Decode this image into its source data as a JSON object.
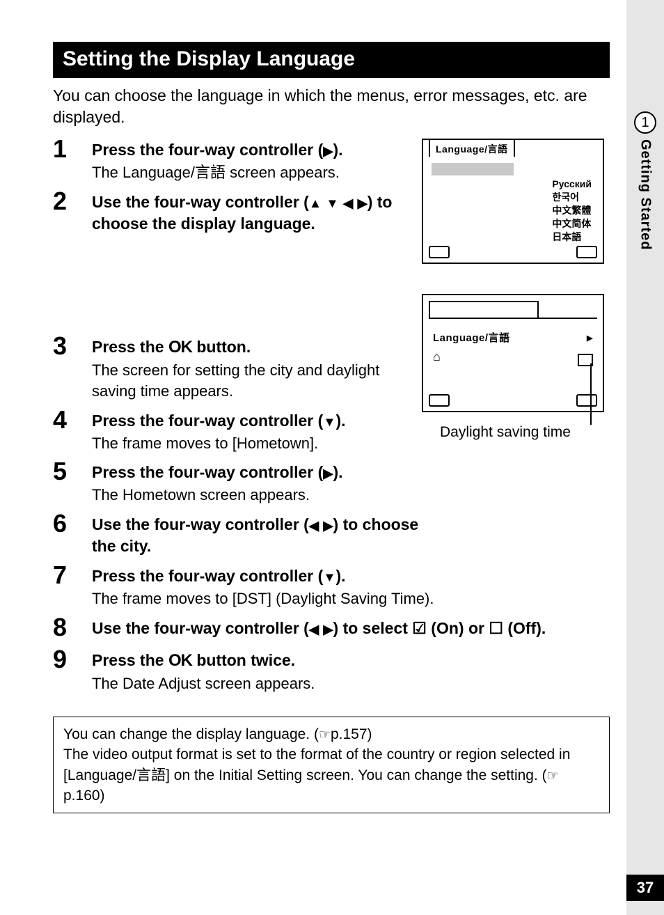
{
  "sidebar": {
    "chapter_num": "1",
    "chapter_label": "Getting Started",
    "page_number": "37"
  },
  "heading": "Setting the Display Language",
  "intro": "You can choose the language in which the menus, error messages, etc. are displayed.",
  "steps": [
    {
      "num": "1",
      "title_parts": [
        "Press the four-way controller (",
        ")."
      ],
      "desc_parts": [
        "The Language/",
        "言語",
        " screen appears."
      ]
    },
    {
      "num": "2",
      "title_parts": [
        "Use the four-way controller (",
        ") to choose the display language."
      ]
    },
    {
      "num": "3",
      "title_parts": [
        "Press the ",
        " button."
      ],
      "desc": "The screen for setting the city and daylight saving time appears."
    },
    {
      "num": "4",
      "title_parts": [
        "Press the four-way controller (",
        ")."
      ],
      "desc": "The frame moves to [Hometown]."
    },
    {
      "num": "5",
      "title_parts": [
        "Press the four-way controller (",
        ")."
      ],
      "desc": "The Hometown screen appears."
    },
    {
      "num": "6",
      "title_parts": [
        "Use the four-way controller (",
        ") to choose the city."
      ]
    },
    {
      "num": "7",
      "title_parts": [
        "Press the four-way controller (",
        ")."
      ],
      "desc": "The frame moves to [DST] (Daylight Saving Time)."
    },
    {
      "num": "8",
      "title_parts": [
        "Use the four-way controller (",
        ") to select ",
        " (On) or ",
        " (Off)."
      ]
    },
    {
      "num": "9",
      "title_parts": [
        "Press the ",
        " button twice."
      ],
      "desc": "The Date Adjust screen appears."
    }
  ],
  "ok_label": "OK",
  "screen1": {
    "tab": "Language/言語",
    "langs": [
      "Русский",
      "한국어",
      "中文繁體",
      "中文简体",
      "日本語"
    ]
  },
  "screen2": {
    "row_label": "Language/言語",
    "home_icon": "⌂",
    "caption": "Daylight saving time"
  },
  "note": {
    "line1a": "You can change the display language. (",
    "line1b": "p.157)",
    "line2a": "The video output format is set to the format of the country or region selected in [Language/",
    "line2b": "言語",
    "line2c": "] on the Initial Setting screen. You can change the setting. (",
    "line2d": "p.160)"
  }
}
